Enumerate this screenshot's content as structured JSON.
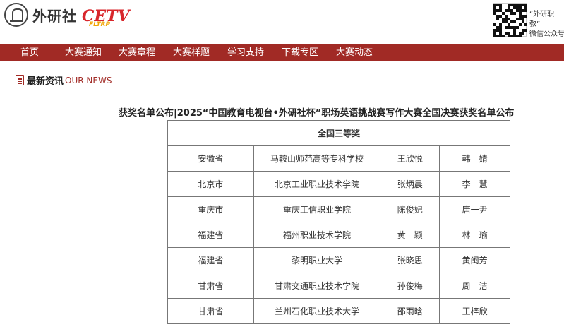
{
  "header": {
    "brand": "外研社",
    "cetv_mark": "CETV",
    "cetv_sub": "FLTRP",
    "qr_caption_line1": "“外研职教”",
    "qr_caption_line2": "微信公众号"
  },
  "nav": {
    "items": [
      "首页",
      "大赛通知",
      "大赛章程",
      "大赛样题",
      "学习支持",
      "下载专区",
      "大赛动态"
    ]
  },
  "section": {
    "title_cn": "最新资讯",
    "title_en": "OUR NEWS"
  },
  "article": {
    "title": "获奖名单公布|2025“中国教育电视台•外研社杯”职场英语挑战赛写作大赛全国决赛获奖名单公布",
    "table_heading": "全国三等奖",
    "rows": [
      {
        "province": "安徽省",
        "school": "马鞍山师范高等专科学校",
        "student": "王欣悦",
        "teacher": "韩　婧"
      },
      {
        "province": "北京市",
        "school": "北京工业职业技术学院",
        "student": "张炳晨",
        "teacher": "李　慧"
      },
      {
        "province": "重庆市",
        "school": "重庆工信职业学院",
        "student": "陈俊妃",
        "teacher": "唐一尹"
      },
      {
        "province": "福建省",
        "school": "福州职业技术学院",
        "student": "黄　颖",
        "teacher": "林　瑜"
      },
      {
        "province": "福建省",
        "school": "黎明职业大学",
        "student": "张晓思",
        "teacher": "黄闽芳"
      },
      {
        "province": "甘肃省",
        "school": "甘肃交通职业技术学院",
        "student": "孙俊梅",
        "teacher": "周　洁"
      },
      {
        "province": "甘肃省",
        "school": "兰州石化职业技术大学",
        "student": "邵雨晗",
        "teacher": "王梓欣"
      }
    ]
  },
  "colors": {
    "nav_bg": "#a12a25",
    "accent": "#a12a25"
  }
}
